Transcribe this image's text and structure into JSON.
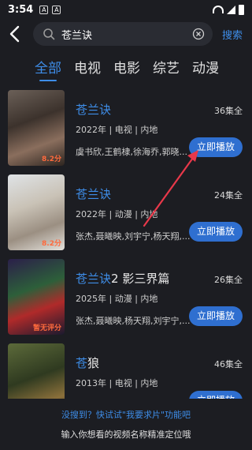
{
  "status_bar": {
    "time": "3:54",
    "icons": [
      "A",
      "A"
    ]
  },
  "search": {
    "value": "苍兰诀",
    "action_label": "搜索"
  },
  "tabs": [
    {
      "label": "全部",
      "active": true
    },
    {
      "label": "电视",
      "active": false
    },
    {
      "label": "电影",
      "active": false
    },
    {
      "label": "综艺",
      "active": false
    },
    {
      "label": "动漫",
      "active": false
    }
  ],
  "results": [
    {
      "title_hl": "苍兰诀",
      "title_rest": "",
      "meta": "2022年 | 电视 | 内地",
      "cast": "虞书欣,王鹤棣,徐海乔,郭晓...",
      "count": "36集全",
      "rating": "8.2分",
      "play": "立即播放"
    },
    {
      "title_hl": "苍兰诀",
      "title_rest": "",
      "meta": "2022年 | 动漫 | 内地",
      "cast": "张杰,聂曦映,刘宇宁,杨天翔,...",
      "count": "24集全",
      "rating": "8.2分",
      "play": "立即播放"
    },
    {
      "title_hl": "苍兰诀",
      "title_rest": "2 影三界篇",
      "meta": "2025年 | 动漫 | 内地",
      "cast": "张杰,聂曦映,杨天翔,刘宇宁,...",
      "count": "26集全",
      "rating": "暂无评分",
      "play": "立即播放"
    },
    {
      "title_hl": "苍",
      "title_rest": "狼",
      "meta": "2013年 | 电视 | 内地",
      "cast": "",
      "count": "46集全",
      "rating": "",
      "play": "立即播放"
    }
  ],
  "footer": {
    "hint1": "没搜到？快试试\"我要求片\"功能吧",
    "hint2": "输入你想看的视频名称精准定位哦"
  },
  "colors": {
    "accent": "#3e8de8",
    "button": "#2f6fd0",
    "background": "#1c1d22",
    "annotation_arrow": "#e8384a"
  }
}
